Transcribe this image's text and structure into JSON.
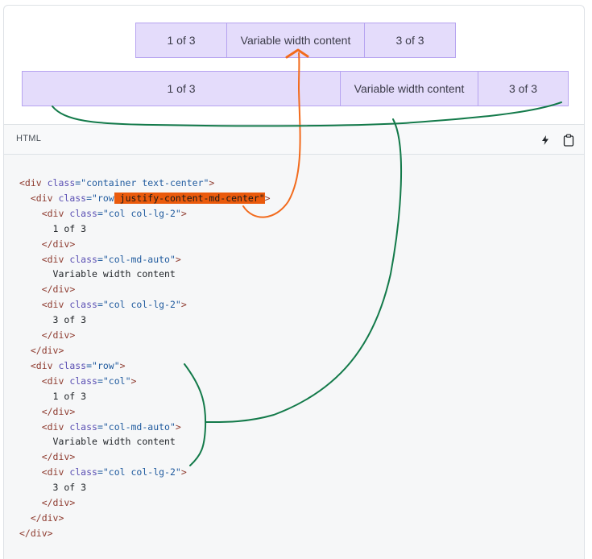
{
  "preview": {
    "row1": [
      "1 of 3",
      "Variable width content",
      "3 of 3"
    ],
    "row2": [
      "1 of 3",
      "Variable width content",
      "3 of 3"
    ]
  },
  "code_header": {
    "language": "HTML",
    "icons": [
      "lightning-icon",
      "clipboard-icon"
    ]
  },
  "code_lines": [
    [
      {
        "t": "<div ",
        "c": "tag"
      },
      {
        "t": "class",
        "c": "attr"
      },
      {
        "t": "=\"container text-center\"",
        "c": "val"
      },
      {
        "t": ">",
        "c": "tag"
      }
    ],
    [
      {
        "t": "  "
      },
      {
        "t": "<div ",
        "c": "tag"
      },
      {
        "t": "class",
        "c": "attr"
      },
      {
        "t": "=\"row",
        "c": "val"
      },
      {
        "t": " justify-content-md-center\"",
        "c": "hl"
      },
      {
        "t": ">",
        "c": "tag"
      }
    ],
    [
      {
        "t": "    "
      },
      {
        "t": "<div ",
        "c": "tag"
      },
      {
        "t": "class",
        "c": "attr"
      },
      {
        "t": "=\"col col-lg-2\"",
        "c": "val"
      },
      {
        "t": ">",
        "c": "tag"
      }
    ],
    [
      {
        "t": "      1 of 3",
        "c": "txt"
      }
    ],
    [
      {
        "t": "    "
      },
      {
        "t": "</div>",
        "c": "tag"
      }
    ],
    [
      {
        "t": "    "
      },
      {
        "t": "<div ",
        "c": "tag"
      },
      {
        "t": "class",
        "c": "attr"
      },
      {
        "t": "=\"col-md-auto\"",
        "c": "val"
      },
      {
        "t": ">",
        "c": "tag"
      }
    ],
    [
      {
        "t": "      Variable width content",
        "c": "txt"
      }
    ],
    [
      {
        "t": "    "
      },
      {
        "t": "</div>",
        "c": "tag"
      }
    ],
    [
      {
        "t": "    "
      },
      {
        "t": "<div ",
        "c": "tag"
      },
      {
        "t": "class",
        "c": "attr"
      },
      {
        "t": "=\"col col-lg-2\"",
        "c": "val"
      },
      {
        "t": ">",
        "c": "tag"
      }
    ],
    [
      {
        "t": "      3 of 3",
        "c": "txt"
      }
    ],
    [
      {
        "t": "    "
      },
      {
        "t": "</div>",
        "c": "tag"
      }
    ],
    [
      {
        "t": "  "
      },
      {
        "t": "</div>",
        "c": "tag"
      }
    ],
    [
      {
        "t": "  "
      },
      {
        "t": "<div ",
        "c": "tag"
      },
      {
        "t": "class",
        "c": "attr"
      },
      {
        "t": "=\"row\"",
        "c": "val"
      },
      {
        "t": ">",
        "c": "tag"
      }
    ],
    [
      {
        "t": "    "
      },
      {
        "t": "<div ",
        "c": "tag"
      },
      {
        "t": "class",
        "c": "attr"
      },
      {
        "t": "=\"col\"",
        "c": "val"
      },
      {
        "t": ">",
        "c": "tag"
      }
    ],
    [
      {
        "t": "      1 of 3",
        "c": "txt"
      }
    ],
    [
      {
        "t": "    "
      },
      {
        "t": "</div>",
        "c": "tag"
      }
    ],
    [
      {
        "t": "    "
      },
      {
        "t": "<div ",
        "c": "tag"
      },
      {
        "t": "class",
        "c": "attr"
      },
      {
        "t": "=\"col-md-auto\"",
        "c": "val"
      },
      {
        "t": ">",
        "c": "tag"
      }
    ],
    [
      {
        "t": "      Variable width content",
        "c": "txt"
      }
    ],
    [
      {
        "t": "    "
      },
      {
        "t": "</div>",
        "c": "tag"
      }
    ],
    [
      {
        "t": "    "
      },
      {
        "t": "<div ",
        "c": "tag"
      },
      {
        "t": "class",
        "c": "attr"
      },
      {
        "t": "=\"col col-lg-2\"",
        "c": "val"
      },
      {
        "t": ">",
        "c": "tag"
      }
    ],
    [
      {
        "t": "      3 of 3",
        "c": "txt"
      }
    ],
    [
      {
        "t": "    "
      },
      {
        "t": "</div>",
        "c": "tag"
      }
    ],
    [
      {
        "t": "  "
      },
      {
        "t": "</div>",
        "c": "tag"
      }
    ],
    [
      {
        "t": "</div>",
        "c": "tag"
      }
    ]
  ],
  "colors": {
    "cell_bg": "#e4dcfb",
    "cell_border": "#b6a3f0",
    "highlight": "#ea5a0c",
    "annotation_orange": "#f26b1d",
    "annotation_green": "#137a4a"
  }
}
